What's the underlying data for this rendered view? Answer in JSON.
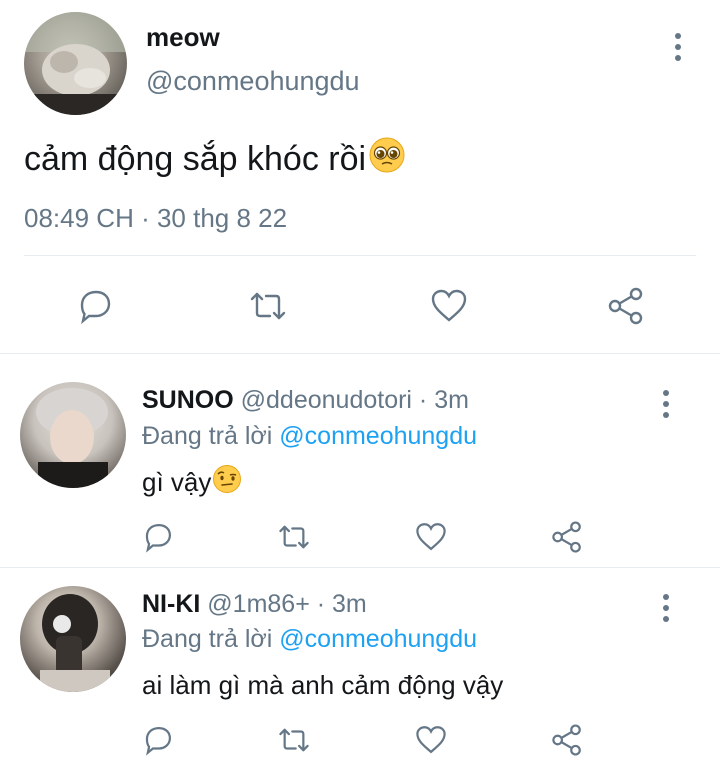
{
  "main_tweet": {
    "display_name": "meow",
    "handle": "@conmeohungdu",
    "text": "cảm động sắp khóc rồi",
    "emoji": "pleading-face-emoji",
    "timestamp": "08:49 CH · 30 thg 8 22",
    "actions": [
      "reply-icon",
      "retweet-icon",
      "like-icon",
      "share-icon"
    ]
  },
  "replies": [
    {
      "display_name": "SUNOO",
      "handle_meta": "@ddeonudotori · 3m",
      "replying_prefix": "Đang trả lời ",
      "replying_to": "@conmeohungdu",
      "text": "gì vậy",
      "emoji": "face-with-raised-eyebrow-emoji"
    },
    {
      "display_name": "NI-KI",
      "handle_meta": "@1m86+ · 3m",
      "replying_prefix": "Đang trả lời ",
      "replying_to": "@conmeohungdu",
      "text": "ai làm gì mà anh cảm động vậy"
    }
  ],
  "colors": {
    "text_primary": "#14171a",
    "text_secondary": "#657786",
    "mention": "#1da1f2",
    "icon": "#657786",
    "divider": "#e6ecf0"
  }
}
